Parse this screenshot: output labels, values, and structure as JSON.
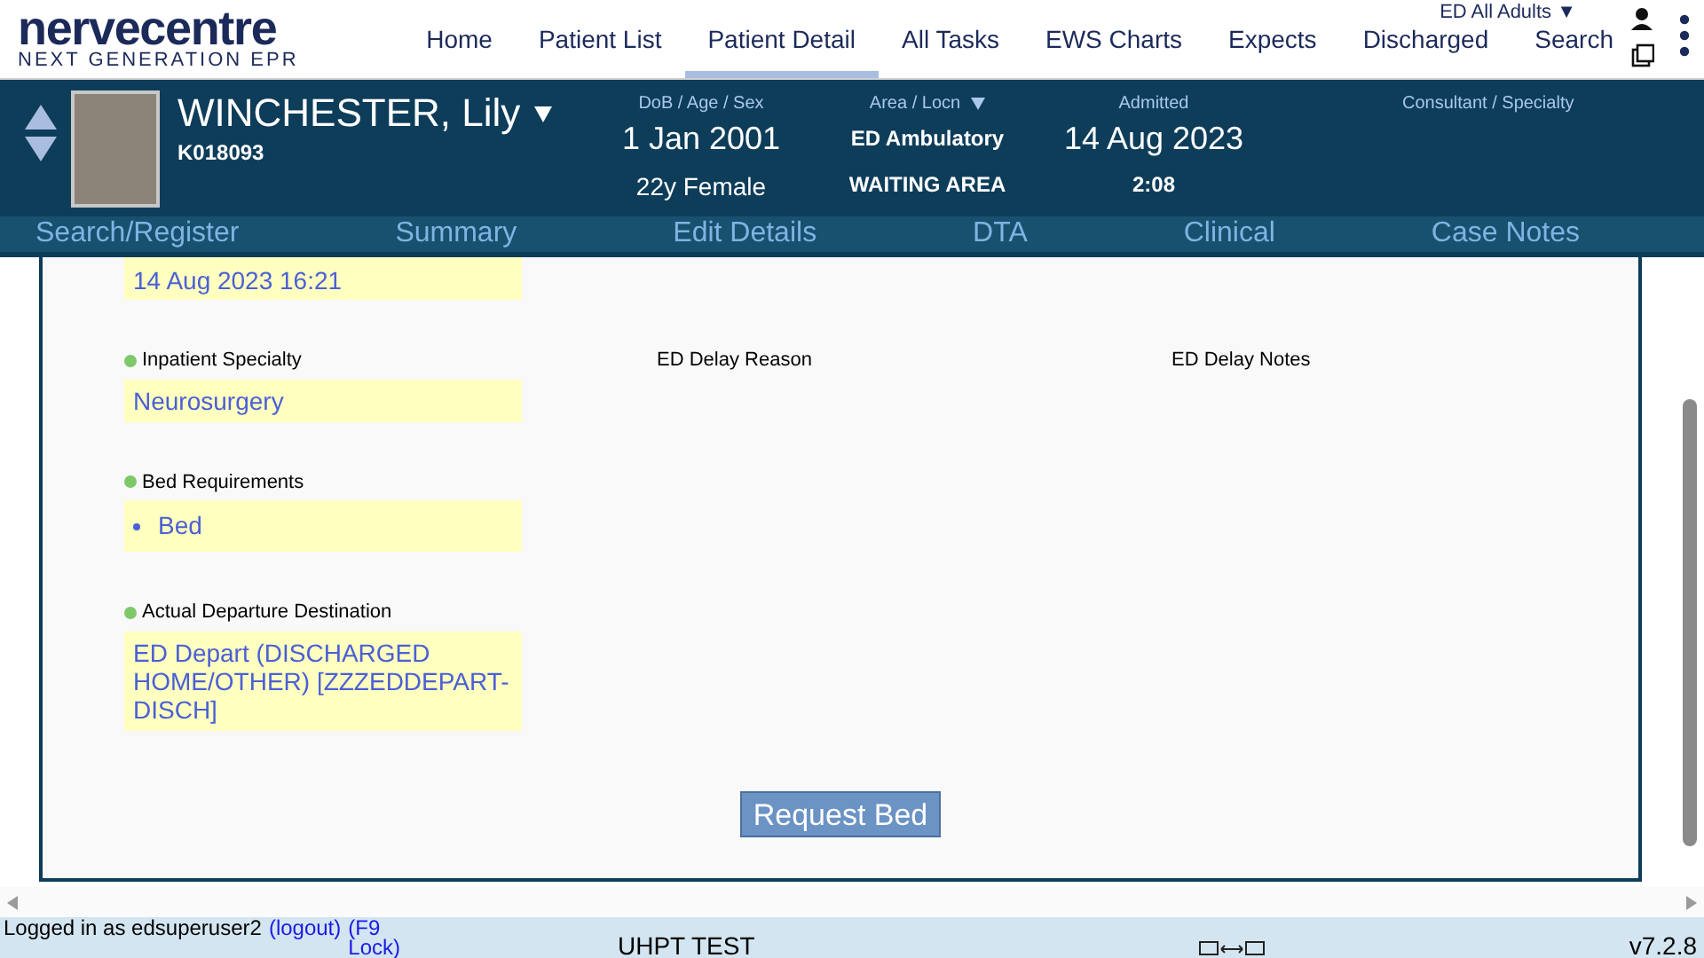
{
  "logo": {
    "name": "nervecentre",
    "tagline": "NEXT GENERATION EPR"
  },
  "nav": [
    {
      "label": "Home",
      "selected": false
    },
    {
      "label": "Patient List",
      "selected": false
    },
    {
      "label": "Patient Detail",
      "selected": true
    },
    {
      "label": "All Tasks",
      "selected": false
    },
    {
      "label": "EWS Charts",
      "selected": false
    },
    {
      "label": "Expects",
      "selected": false
    },
    {
      "label": "Discharged",
      "selected": false
    },
    {
      "label": "Search",
      "selected": false
    }
  ],
  "ward_selector": "ED All Adults ▼",
  "patient": {
    "name": "WINCHESTER, Lily",
    "id": "K018093",
    "dob_label": "DoB / Age / Sex",
    "dob": "1 Jan 2001",
    "age_sex": "22y Female",
    "area_label": "Area / Locn",
    "area": "ED Ambulatory",
    "location": "WAITING AREA",
    "admitted_label": "Admitted",
    "admitted": "14 Aug 2023",
    "duration": "2:08",
    "consultant_label": "Consultant / Specialty"
  },
  "subnav": [
    "Search/Register",
    "Summary",
    "Edit Details",
    "DTA",
    "Clinical",
    "Case Notes"
  ],
  "fields": [
    {
      "label": "Inpatient Specialty",
      "value": "Neurosurgery",
      "kind": "text"
    },
    {
      "label": "Bed Requirements",
      "value": "Bed",
      "kind": "list"
    },
    {
      "label": "Actual Departure Destination",
      "value": "ED Depart (DISCHARGED HOME/OTHER) [ZZZEDDEPART-DISCH]",
      "kind": "text"
    }
  ],
  "top_value": "14 Aug 2023 16:21",
  "delay_reason_label": "ED Delay Reason",
  "delay_notes_label": "ED Delay Notes",
  "request_button": "Request Bed",
  "footer": {
    "login": "Logged in as edsuperuser2",
    "logout": "(logout)",
    "lock": "(F9 Lock)",
    "env": "UHPT TEST",
    "version": "v7.2.8"
  }
}
